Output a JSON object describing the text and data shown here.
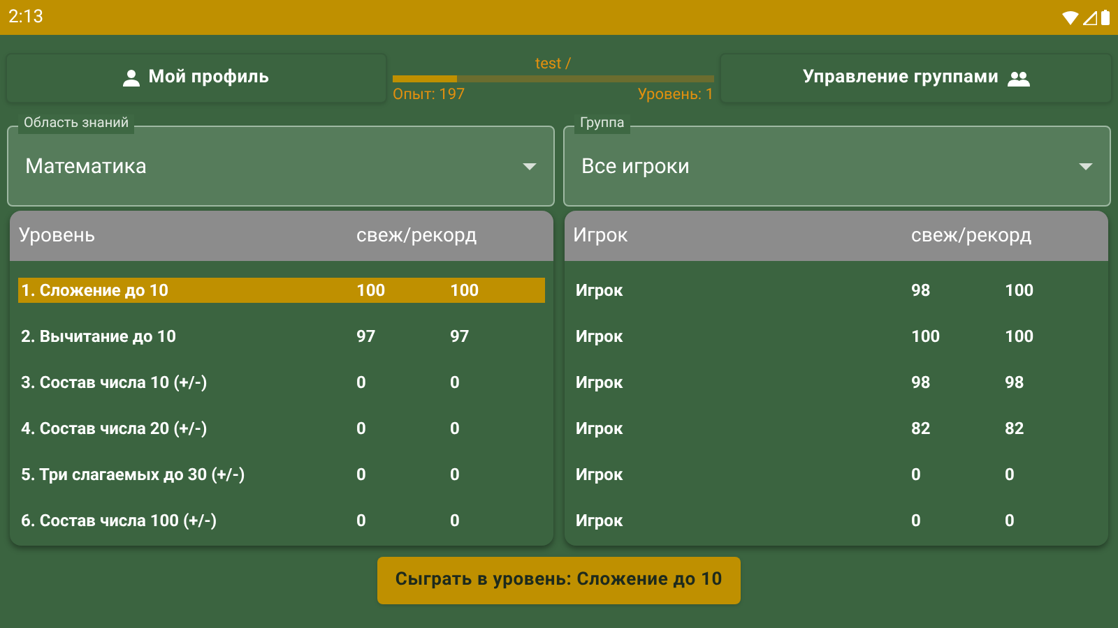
{
  "status_bar": {
    "time": "2:13"
  },
  "header": {
    "profile_button": "Мой профиль",
    "user": "test /",
    "experience": {
      "level": 0.2,
      "label": "Опыт: 197",
      "rank": "Уровень: 1"
    },
    "groups_button": "Управление группами"
  },
  "subject_select": {
    "label": "Область знаний",
    "value": "Математика"
  },
  "group_select": {
    "label": "Группа",
    "value": "Все игроки"
  },
  "levels_table": {
    "columns": [
      "Уровень",
      "свеж/рекорд"
    ],
    "rows": [
      {
        "name": "1. Сложение до 10",
        "fresh": "100",
        "record": "100",
        "selected": true
      },
      {
        "name": "2. Вычитание до 10",
        "fresh": "97",
        "record": "97",
        "selected": false
      },
      {
        "name": "3. Состав числа 10 (+/-)",
        "fresh": "0",
        "record": "0",
        "selected": false
      },
      {
        "name": "4. Состав числа 20 (+/-)",
        "fresh": "0",
        "record": "0",
        "selected": false
      },
      {
        "name": "5. Три слагаемых до 30 (+/-)",
        "fresh": "0",
        "record": "0",
        "selected": false
      },
      {
        "name": "6. Состав числа 100 (+/-)",
        "fresh": "0",
        "record": "0",
        "selected": false
      }
    ]
  },
  "players_table": {
    "columns": [
      "Игрок",
      "свеж/рекорд"
    ],
    "rows": [
      {
        "name": "Игрок",
        "fresh": "98",
        "record": "100"
      },
      {
        "name": "Игрок",
        "fresh": "100",
        "record": "100"
      },
      {
        "name": "Игрок",
        "fresh": "98",
        "record": "98"
      },
      {
        "name": "Игрок",
        "fresh": "82",
        "record": "82"
      },
      {
        "name": "Игрок",
        "fresh": "0",
        "record": "0"
      },
      {
        "name": "Игрок",
        "fresh": "0",
        "record": "0"
      }
    ]
  },
  "play_button": "Сыграть в уровень: Сложение до 10"
}
